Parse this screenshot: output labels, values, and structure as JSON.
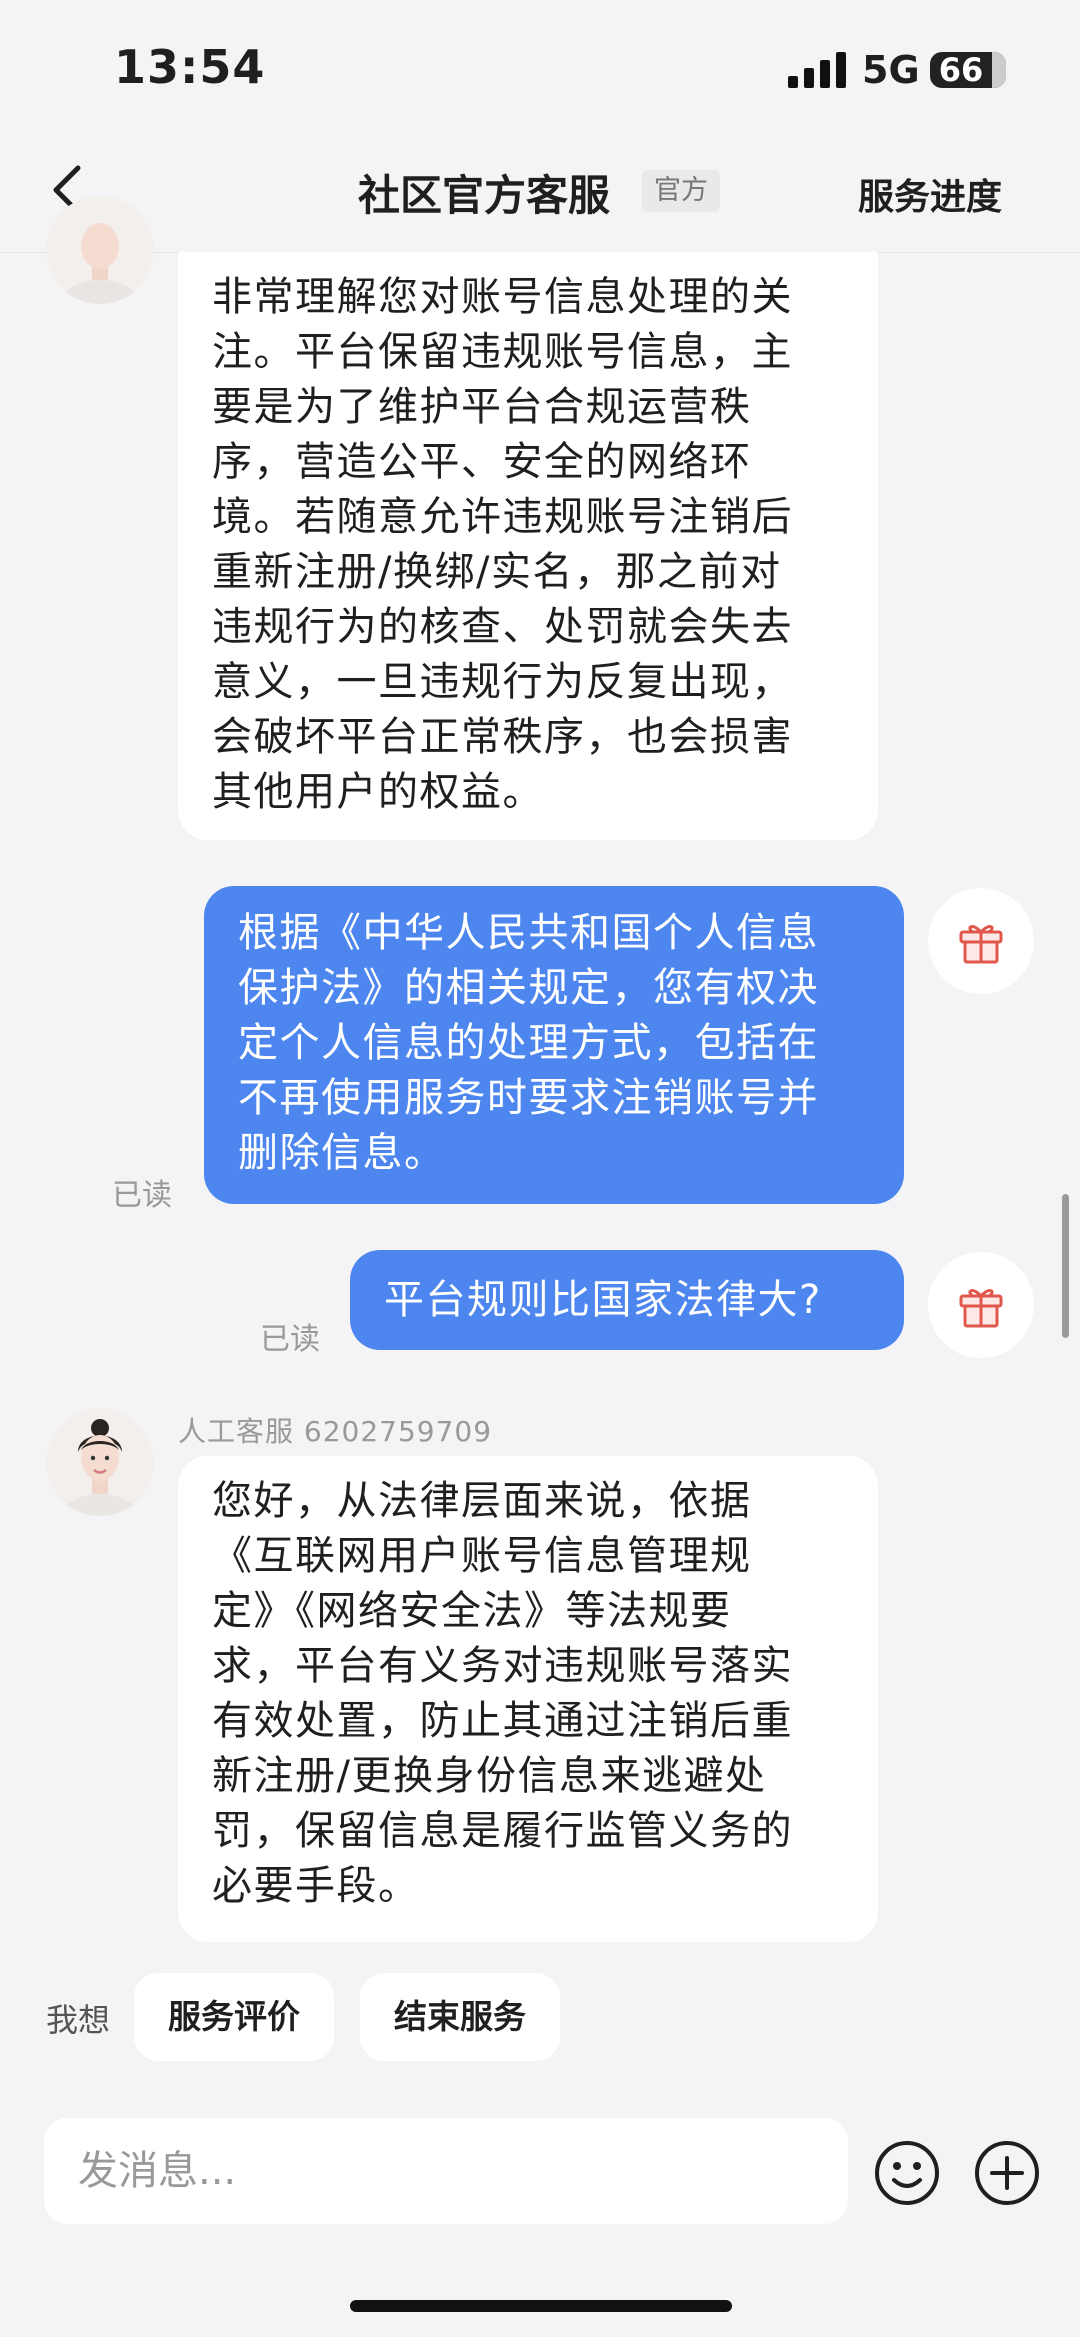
{
  "status_bar": {
    "time": "13:54",
    "network": "5G",
    "battery": "66"
  },
  "nav": {
    "title": "社区官方客服",
    "tag": "官方",
    "action": "服务进度"
  },
  "messages": {
    "m1": {
      "lines": [
        "非常理解您对账号信息处理的关",
        "注。平台保留违规账号信息，主",
        "要是为了维护平台合规运营秩",
        "序，营造公平、安全的网络环",
        "境。若随意允许违规账号注销后",
        "重新注册/换绑/实名，那之前对",
        "违规行为的核查、处罚就会失去",
        "意义，一旦违规行为反复出现，",
        "会破坏平台正常秩序，也会损害",
        "其他用户的权益。"
      ]
    },
    "m2": {
      "lines": [
        "根据《中华人民共和国个人信息",
        "保护法》的相关规定，您有权决",
        "定个人信息的处理方式，包括在",
        "不再使用服务时要求注销账号并",
        "删除信息。"
      ],
      "read": "已读"
    },
    "m3": {
      "text": "平台规则比国家法律大?",
      "read": "已读"
    },
    "m4": {
      "sender": "人工客服 6202759709",
      "lines": [
        "您好，从法律层面来说，依据",
        "《互联网用户账号信息管理规",
        "定》《网络安全法》等法规要",
        "求，平台有义务对违规账号落实",
        "有效处置，防止其通过注销后重",
        "新注册/更换身份信息来逃避处",
        "罚，保留信息是履行监管义务的",
        "必要手段。"
      ]
    }
  },
  "quick_actions": {
    "label": "我想",
    "rate": "服务评价",
    "end": "结束服务"
  },
  "input": {
    "placeholder": "发消息..."
  },
  "colors": {
    "user_bubble": "#4c86ee",
    "background": "#f4f4f6"
  }
}
